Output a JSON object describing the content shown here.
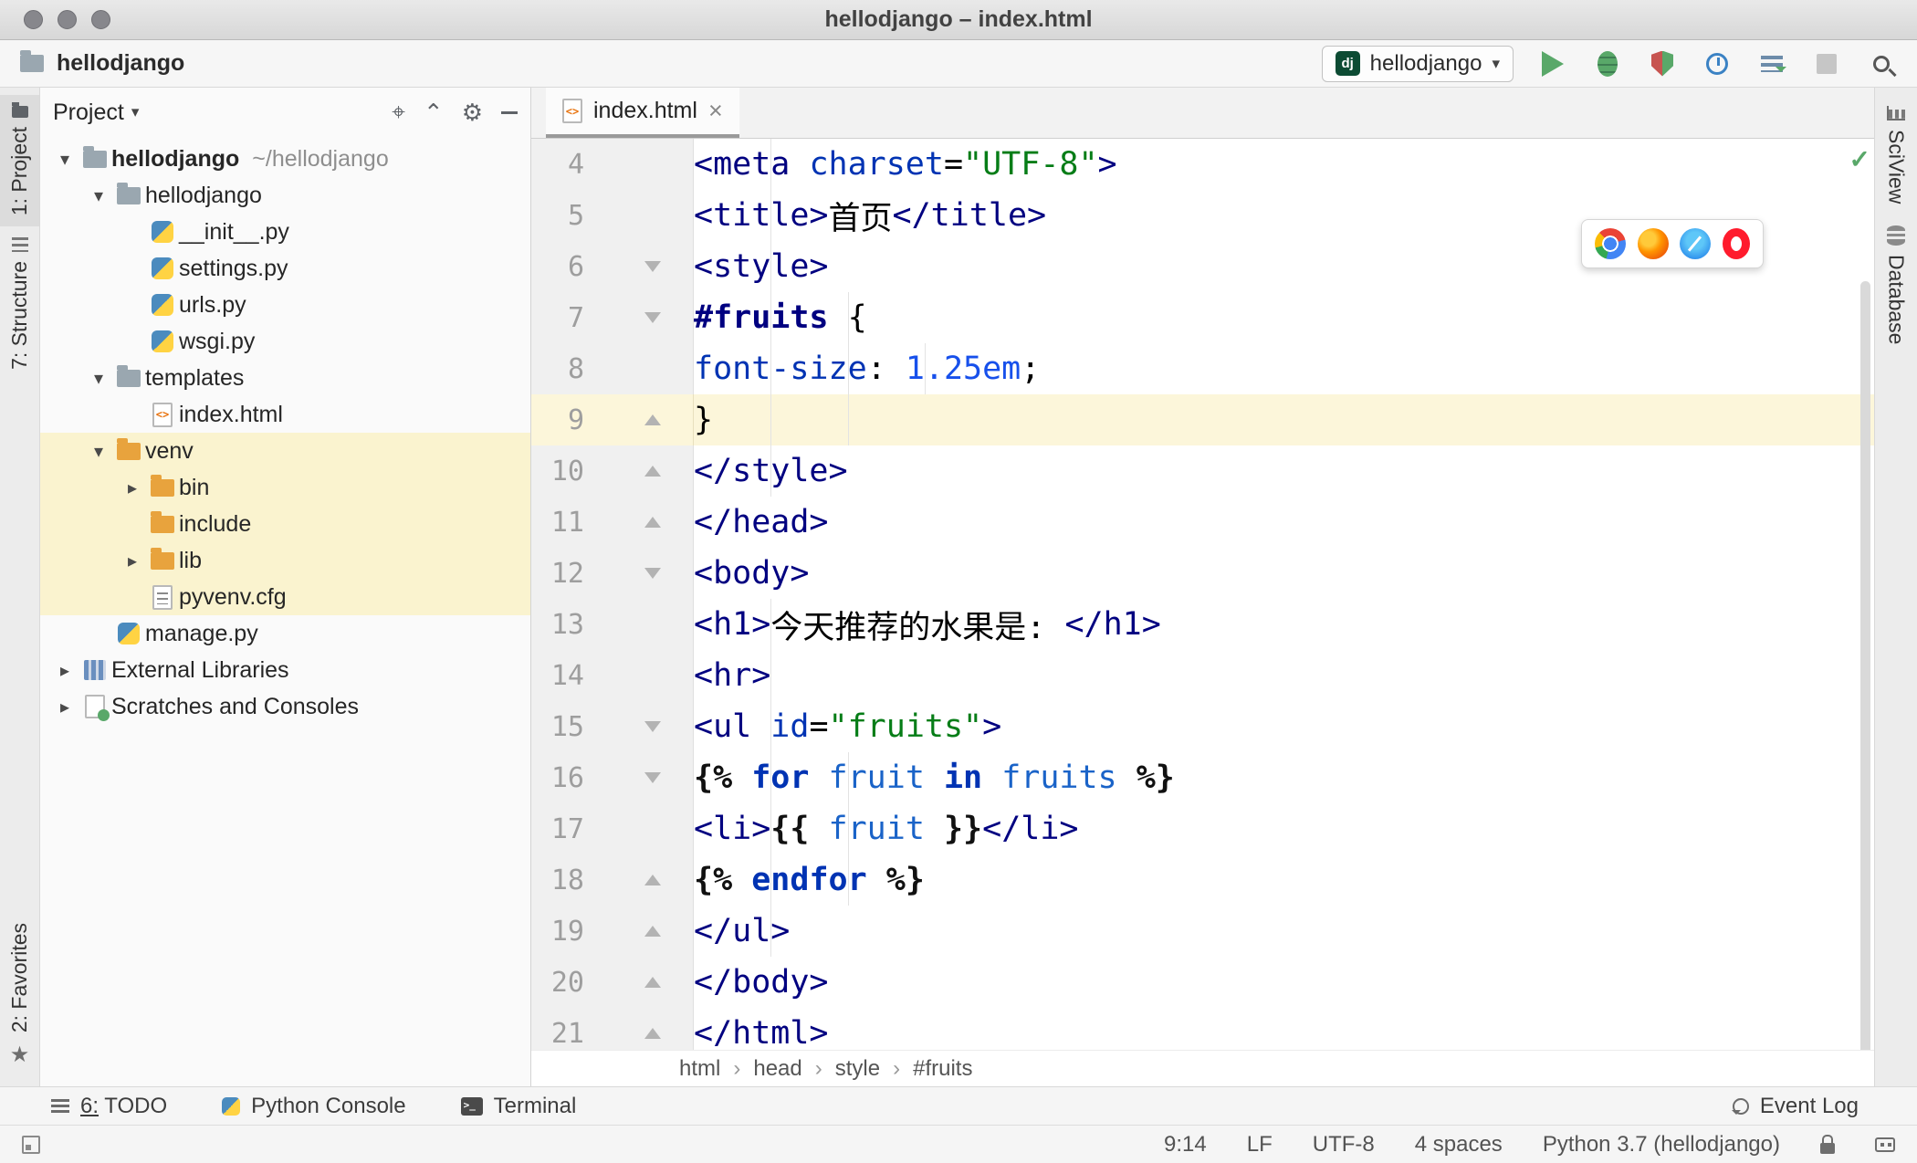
{
  "window": {
    "title": "hellodjango – index.html"
  },
  "toolbar": {
    "project_name": "hellodjango",
    "run_config": {
      "badge": "dj",
      "name": "hellodjango"
    },
    "buttons": [
      "run",
      "debug",
      "run-with-coverage",
      "profile",
      "concurrency-diagram",
      "stop",
      "search-everywhere"
    ]
  },
  "left_strip": {
    "items": [
      "1: Project",
      "7: Structure",
      "2: Favorites"
    ]
  },
  "right_strip": {
    "items": [
      "SciView",
      "Database"
    ]
  },
  "project_panel": {
    "header": "Project",
    "tree": [
      {
        "label": "hellodjango",
        "hint": "~/hellodjango",
        "icon": "folder",
        "level": 0,
        "chevron": "open",
        "bold": true
      },
      {
        "label": "hellodjango",
        "icon": "folder",
        "level": 1,
        "chevron": "open"
      },
      {
        "label": "__init__.py",
        "icon": "python",
        "level": 2
      },
      {
        "label": "settings.py",
        "icon": "python",
        "level": 2
      },
      {
        "label": "urls.py",
        "icon": "python",
        "level": 2
      },
      {
        "label": "wsgi.py",
        "icon": "python",
        "level": 2
      },
      {
        "label": "templates",
        "icon": "folder",
        "level": 1,
        "chevron": "open"
      },
      {
        "label": "index.html",
        "icon": "html",
        "level": 2
      },
      {
        "label": "venv",
        "icon": "folder-excluded",
        "level": 1,
        "chevron": "open",
        "highlight": true
      },
      {
        "label": "bin",
        "icon": "folder-excluded",
        "level": 2,
        "chevron": "closed",
        "highlight": true
      },
      {
        "label": "include",
        "icon": "folder-excluded",
        "level": 2,
        "highlight": true
      },
      {
        "label": "lib",
        "icon": "folder-excluded",
        "level": 2,
        "chevron": "closed",
        "highlight": true
      },
      {
        "label": "pyvenv.cfg",
        "icon": "config",
        "level": 2,
        "highlight": true
      },
      {
        "label": "manage.py",
        "icon": "python",
        "level": 1
      },
      {
        "label": "External Libraries",
        "icon": "libraries",
        "level": 0,
        "chevron": "closed"
      },
      {
        "label": "Scratches and Consoles",
        "icon": "scratches",
        "level": 0,
        "chevron": "closed"
      }
    ]
  },
  "editor": {
    "tab": {
      "label": "index.html"
    },
    "breadcrumbs": [
      "html",
      "head",
      "style",
      "#fruits"
    ],
    "lines": [
      {
        "num": 4,
        "indent": 8,
        "guides": [
          4
        ],
        "tokens": [
          [
            "tag",
            "<meta"
          ],
          [
            "pl",
            " "
          ],
          [
            "attr",
            "charset"
          ],
          [
            "pl",
            "="
          ],
          [
            "str",
            "\"UTF-8\""
          ],
          [
            "tag",
            ">"
          ]
        ]
      },
      {
        "num": 5,
        "indent": 8,
        "guides": [
          4
        ],
        "tokens": [
          [
            "tag",
            "<title>"
          ],
          [
            "txt",
            "首页"
          ],
          [
            "tag",
            "</title>"
          ]
        ]
      },
      {
        "num": 6,
        "indent": 8,
        "guides": [
          4
        ],
        "fold": "start",
        "tokens": [
          [
            "tag",
            "<style>"
          ]
        ]
      },
      {
        "num": 7,
        "indent": 12,
        "guides": [
          4,
          8
        ],
        "fold": "start",
        "tokens": [
          [
            "sel",
            "#fruits"
          ],
          [
            "pl",
            " {"
          ]
        ]
      },
      {
        "num": 8,
        "indent": 16,
        "guides": [
          4,
          8,
          12
        ],
        "tokens": [
          [
            "attr",
            "font-size"
          ],
          [
            "pl",
            ": "
          ],
          [
            "num",
            "1.25em"
          ],
          [
            "pl",
            ";"
          ]
        ]
      },
      {
        "num": 9,
        "indent": 12,
        "guides": [
          4,
          8
        ],
        "fold": "end",
        "current": true,
        "tokens": [
          [
            "pl",
            "}"
          ]
        ]
      },
      {
        "num": 10,
        "indent": 8,
        "guides": [
          4
        ],
        "fold": "end",
        "tokens": [
          [
            "tag",
            "</style>"
          ]
        ]
      },
      {
        "num": 11,
        "indent": 4,
        "guides": [],
        "fold": "end",
        "tokens": [
          [
            "tag",
            "</head>"
          ]
        ]
      },
      {
        "num": 12,
        "indent": 4,
        "guides": [],
        "fold": "start",
        "tokens": [
          [
            "tag",
            "<body>"
          ]
        ]
      },
      {
        "num": 13,
        "indent": 8,
        "guides": [
          4
        ],
        "tokens": [
          [
            "tag",
            "<h1>"
          ],
          [
            "txt",
            "今天推荐的水果是: "
          ],
          [
            "tag",
            "</h1>"
          ]
        ]
      },
      {
        "num": 14,
        "indent": 8,
        "guides": [
          4
        ],
        "tokens": [
          [
            "tag",
            "<hr>"
          ]
        ]
      },
      {
        "num": 15,
        "indent": 8,
        "guides": [
          4
        ],
        "fold": "start",
        "tokens": [
          [
            "tag",
            "<ul"
          ],
          [
            "pl",
            " "
          ],
          [
            "attr",
            "id"
          ],
          [
            "pl",
            "="
          ],
          [
            "str",
            "\"fruits\""
          ],
          [
            "tag",
            ">"
          ]
        ]
      },
      {
        "num": 16,
        "indent": 12,
        "guides": [
          4,
          8
        ],
        "fold": "start",
        "tokens": [
          [
            "br",
            "{%"
          ],
          [
            "pl",
            " "
          ],
          [
            "kw",
            "for"
          ],
          [
            "pl",
            " "
          ],
          [
            "var",
            "fruit"
          ],
          [
            "pl",
            " "
          ],
          [
            "kw",
            "in"
          ],
          [
            "pl",
            " "
          ],
          [
            "var",
            "fruits"
          ],
          [
            "pl",
            " "
          ],
          [
            "br",
            "%}"
          ]
        ]
      },
      {
        "num": 17,
        "indent": 12,
        "guides": [
          4,
          8
        ],
        "tokens": [
          [
            "tag",
            "<li>"
          ],
          [
            "br",
            "{{"
          ],
          [
            "pl",
            " "
          ],
          [
            "var",
            "fruit"
          ],
          [
            "pl",
            " "
          ],
          [
            "br",
            "}}"
          ],
          [
            "tag",
            "</li>"
          ]
        ]
      },
      {
        "num": 18,
        "indent": 12,
        "guides": [
          4,
          8
        ],
        "fold": "end",
        "tokens": [
          [
            "br",
            "{%"
          ],
          [
            "pl",
            " "
          ],
          [
            "kw",
            "endfor"
          ],
          [
            "pl",
            " "
          ],
          [
            "br",
            "%}"
          ]
        ]
      },
      {
        "num": 19,
        "indent": 8,
        "guides": [
          4
        ],
        "fold": "end",
        "tokens": [
          [
            "tag",
            "</ul>"
          ]
        ]
      },
      {
        "num": 20,
        "indent": 4,
        "guides": [],
        "fold": "end",
        "tokens": [
          [
            "tag",
            "</body>"
          ]
        ]
      },
      {
        "num": 21,
        "indent": 0,
        "guides": [],
        "fold": "end",
        "tokens": [
          [
            "tag",
            "</html>"
          ]
        ]
      }
    ]
  },
  "bottom_bar": {
    "items": [
      "6: TODO",
      "Python Console",
      "Terminal"
    ],
    "right": "Event Log"
  },
  "status_bar": {
    "items": [
      "9:14",
      "LF",
      "UTF-8",
      "4 spaces",
      "Python 3.7 (hellodjango)"
    ]
  },
  "colors": {
    "run_green": "#59a869",
    "django_green": "#0c4b33",
    "caret_row": "#fcf6da",
    "excluded_row": "#faf3cf"
  }
}
